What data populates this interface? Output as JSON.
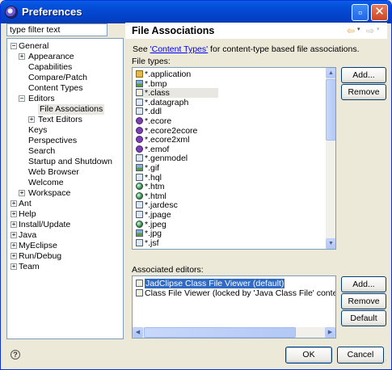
{
  "window": {
    "title": "Preferences"
  },
  "filter": {
    "placeholder": "type filter text"
  },
  "tree": [
    {
      "label": "General",
      "depth": 0,
      "expander": "minus"
    },
    {
      "label": "Appearance",
      "depth": 1,
      "expander": "plus"
    },
    {
      "label": "Capabilities",
      "depth": 1,
      "expander": ""
    },
    {
      "label": "Compare/Patch",
      "depth": 1,
      "expander": ""
    },
    {
      "label": "Content Types",
      "depth": 1,
      "expander": ""
    },
    {
      "label": "Editors",
      "depth": 1,
      "expander": "minus"
    },
    {
      "label": "File Associations",
      "depth": 2,
      "expander": "",
      "selected": true
    },
    {
      "label": "Text Editors",
      "depth": 2,
      "expander": "plus"
    },
    {
      "label": "Keys",
      "depth": 1,
      "expander": ""
    },
    {
      "label": "Perspectives",
      "depth": 1,
      "expander": ""
    },
    {
      "label": "Search",
      "depth": 1,
      "expander": ""
    },
    {
      "label": "Startup and Shutdown",
      "depth": 1,
      "expander": ""
    },
    {
      "label": "Web Browser",
      "depth": 1,
      "expander": ""
    },
    {
      "label": "Welcome",
      "depth": 1,
      "expander": ""
    },
    {
      "label": "Workspace",
      "depth": 1,
      "expander": "plus"
    },
    {
      "label": "Ant",
      "depth": 0,
      "expander": "plus"
    },
    {
      "label": "Help",
      "depth": 0,
      "expander": "plus"
    },
    {
      "label": "Install/Update",
      "depth": 0,
      "expander": "plus"
    },
    {
      "label": "Java",
      "depth": 0,
      "expander": "plus"
    },
    {
      "label": "MyEclipse",
      "depth": 0,
      "expander": "plus"
    },
    {
      "label": "Run/Debug",
      "depth": 0,
      "expander": "plus"
    },
    {
      "label": "Team",
      "depth": 0,
      "expander": "plus"
    }
  ],
  "page": {
    "title": "File Associations",
    "info_prefix": "See ",
    "info_link": "'Content Types'",
    "info_suffix": " for content-type based file associations.",
    "file_types_label": "File types:",
    "associated_editors_label": "Associated editors:"
  },
  "file_types": [
    {
      "name": "*.application",
      "icon": "app-icon"
    },
    {
      "name": "*.bmp",
      "icon": "image-icon"
    },
    {
      "name": "*.class",
      "icon": "class-file-icon",
      "selected": true
    },
    {
      "name": "*.datagraph",
      "icon": "file-icon"
    },
    {
      "name": "*.ddl",
      "icon": "file-icon"
    },
    {
      "name": "*.ecore",
      "icon": "ecore-icon"
    },
    {
      "name": "*.ecore2ecore",
      "icon": "ecore-icon"
    },
    {
      "name": "*.ecore2xml",
      "icon": "ecore-icon"
    },
    {
      "name": "*.emof",
      "icon": "ecore-icon"
    },
    {
      "name": "*.genmodel",
      "icon": "file-icon"
    },
    {
      "name": "*.gif",
      "icon": "image-icon"
    },
    {
      "name": "*.hql",
      "icon": "file-icon"
    },
    {
      "name": "*.htm",
      "icon": "web-globe-icon"
    },
    {
      "name": "*.html",
      "icon": "web-globe-icon"
    },
    {
      "name": "*.jardesc",
      "icon": "file-icon"
    },
    {
      "name": "*.jpage",
      "icon": "file-icon"
    },
    {
      "name": "*.jpeg",
      "icon": "web-globe-icon"
    },
    {
      "name": "*.jpg",
      "icon": "image-icon"
    },
    {
      "name": "*.jsf",
      "icon": "file-icon"
    }
  ],
  "associated_editors": [
    {
      "name": "JadClipse Class File Viewer (default)",
      "selected": true
    },
    {
      "name": "Class File Viewer (locked by 'Java Class File' content type)",
      "selected": false
    }
  ],
  "buttons": {
    "add_file_type": "Add...",
    "remove_file_type": "Remove",
    "add_editor": "Add...",
    "remove_editor": "Remove",
    "default_editor": "Default",
    "ok": "OK",
    "cancel": "Cancel"
  },
  "icons": {
    "help": "help-icon",
    "back": "back-arrow-icon",
    "forward": "forward-arrow-icon"
  }
}
